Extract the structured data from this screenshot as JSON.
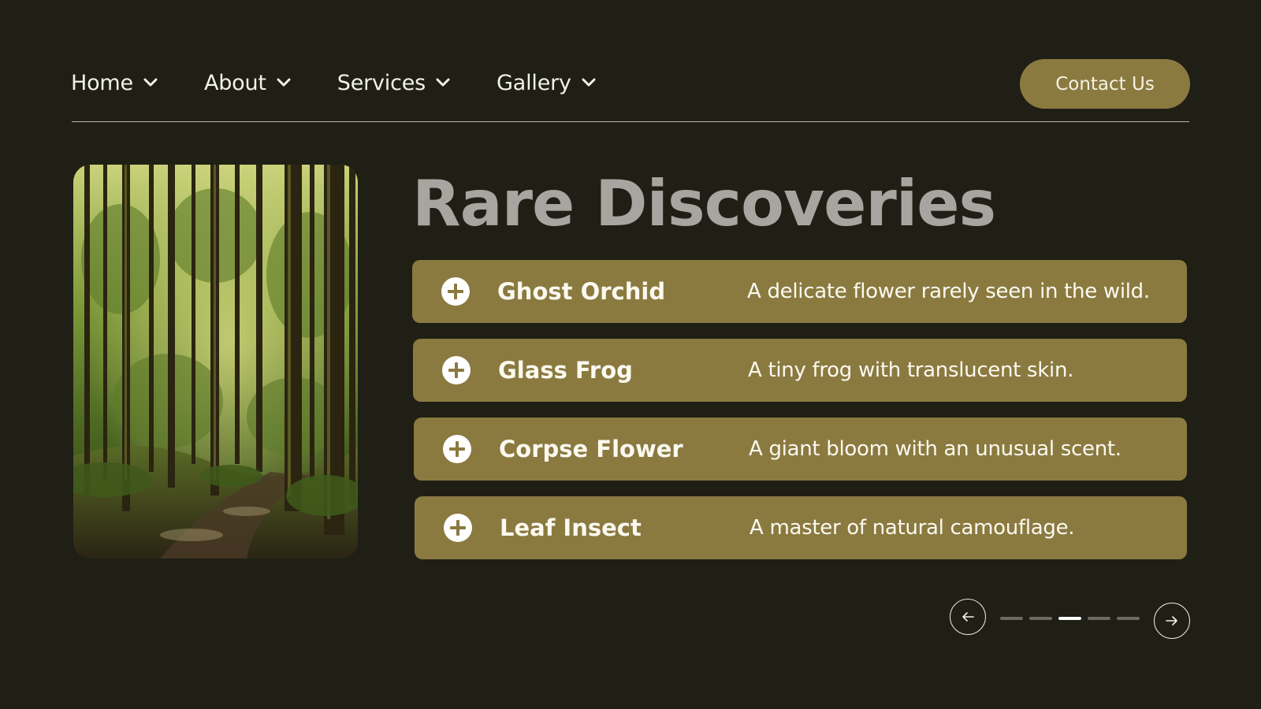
{
  "nav": {
    "items": [
      {
        "label": "Home",
        "icon": "chevron-down-icon"
      },
      {
        "label": "About",
        "icon": "chevron-down-icon"
      },
      {
        "label": "Services",
        "icon": "chevron-down-icon"
      },
      {
        "label": "Gallery",
        "icon": "chevron-down-icon"
      }
    ],
    "contact_label": "Contact Us"
  },
  "hero": {
    "title": "Rare Discoveries",
    "image": "forest-photo"
  },
  "discoveries": [
    {
      "name": "Ghost Orchid",
      "description": "A delicate flower rarely seen in the wild.",
      "icon": "plus-circle-icon"
    },
    {
      "name": "Glass Frog",
      "description": "A tiny frog with translucent skin.",
      "icon": "plus-circle-icon"
    },
    {
      "name": "Corpse Flower",
      "description": "A giant bloom with an unusual scent.",
      "icon": "plus-circle-icon"
    },
    {
      "name": "Leaf Insect",
      "description": "A master of natural camouflage.",
      "icon": "plus-circle-icon"
    }
  ],
  "pager": {
    "total_pages": 5,
    "current_page": 3,
    "prev_icon": "arrow-left-icon",
    "next_icon": "arrow-right-icon"
  },
  "colors": {
    "background": "#1f1f15",
    "accent": "#8b7a40",
    "title": "#a6a5a0"
  }
}
